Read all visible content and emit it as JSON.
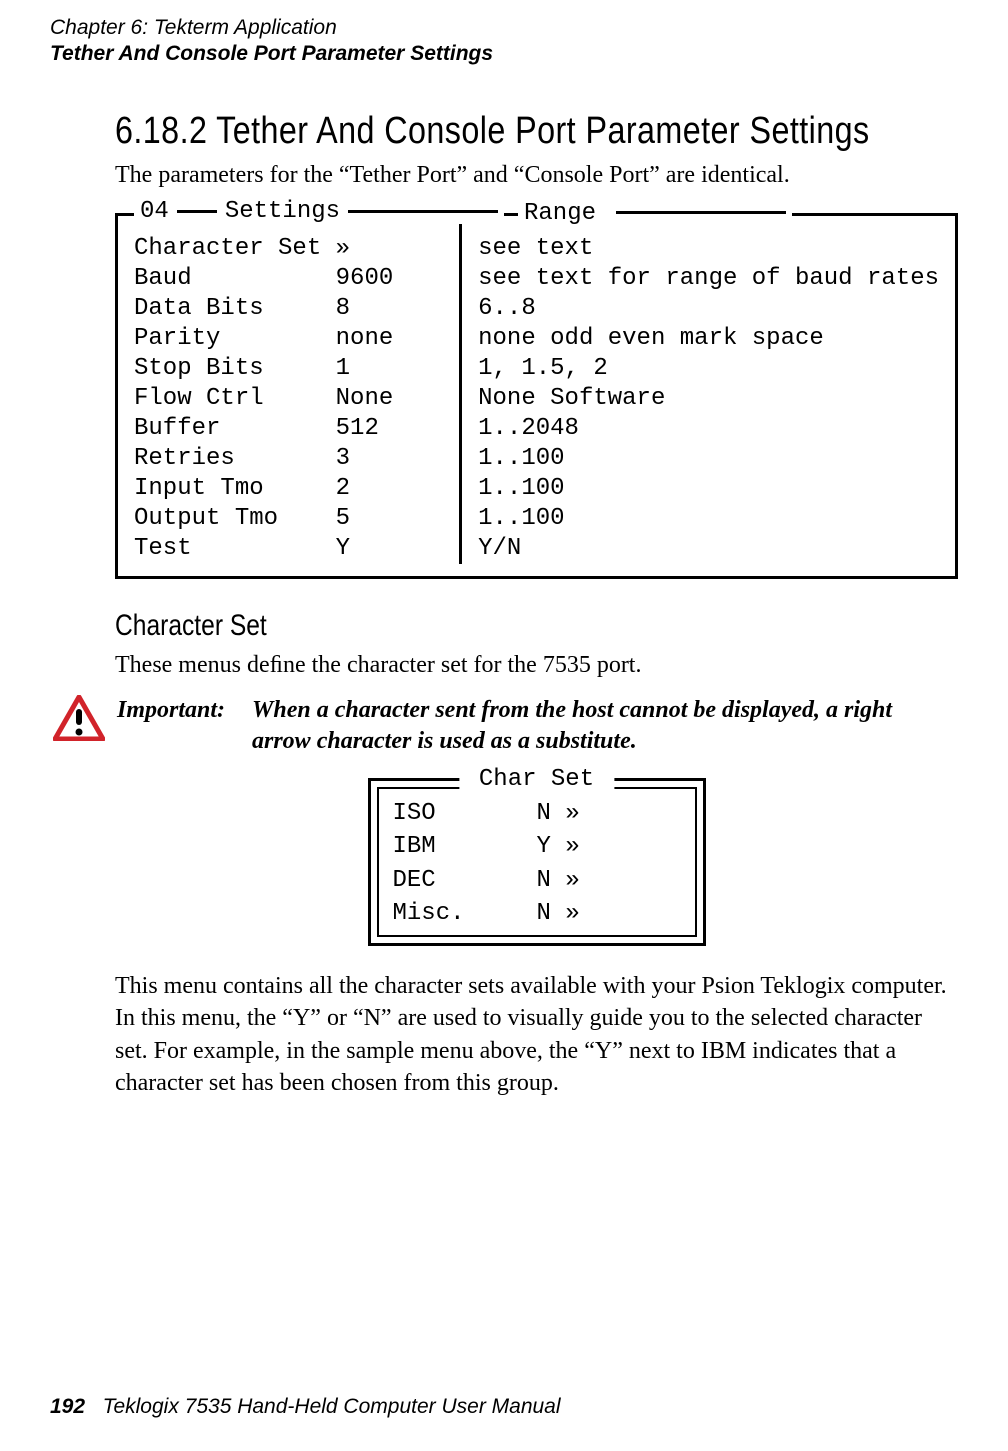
{
  "header": {
    "line1": "Chapter  6:   Tekterm Application",
    "line2": "Tether And Console Port Parameter Settings"
  },
  "section": {
    "number_title": "6.18.2   Tether  And  Console  Port  Parameter  Settings",
    "intro": "The parameters for the “Tether Port” and “Console Port” are identical."
  },
  "settings_frame": {
    "top_left_prefix": "04",
    "top_left_label": "Settings",
    "top_right_label": "Range",
    "rows": [
      {
        "name": "Character Set",
        "value": "»",
        "range": "see text"
      },
      {
        "name": "Baud",
        "value": "9600",
        "range": "see text for range of baud rates"
      },
      {
        "name": "Data Bits",
        "value": "8",
        "range": "6..8"
      },
      {
        "name": "Parity",
        "value": "none",
        "range": "none odd even mark space"
      },
      {
        "name": "Stop Bits",
        "value": "1",
        "range": "1, 1.5, 2"
      },
      {
        "name": "Flow Ctrl",
        "value": "None",
        "range": "None Software"
      },
      {
        "name": "Buffer",
        "value": "512",
        "range": "1..2048"
      },
      {
        "name": "Retries",
        "value": "3",
        "range": "1..100"
      },
      {
        "name": "Input Tmo",
        "value": "2",
        "range": "1..100"
      },
      {
        "name": "Output Tmo",
        "value": "5",
        "range": "1..100"
      },
      {
        "name": "Test",
        "value": "Y",
        "range": "Y/N"
      }
    ]
  },
  "character_set": {
    "heading": "Character Set",
    "intro": "These menus deﬁne the character set for the 7535 port."
  },
  "important": {
    "label": "Important:",
    "message": "When a character sent from the host cannot be displayed, a right arrow character is used as a substitute."
  },
  "charset_frame": {
    "label": "Char Set",
    "rows": [
      {
        "name": "ISO",
        "value": "N",
        "arrow": "»"
      },
      {
        "name": "IBM",
        "value": "Y",
        "arrow": "»"
      },
      {
        "name": "DEC",
        "value": "N",
        "arrow": "»"
      },
      {
        "name": "Misc.",
        "value": "N",
        "arrow": "»"
      }
    ]
  },
  "closing_para": "This menu contains all the character sets available with your Psion Teklogix computer. In this menu, the “Y” or “N” are used to visually guide you to the selected character set. For example, in the sample menu above, the “Y” next to IBM indicates that a character set has been chosen from this group.",
  "footer": {
    "page": "192",
    "text": "Teklogix 7535 Hand-Held Computer User Manual"
  }
}
